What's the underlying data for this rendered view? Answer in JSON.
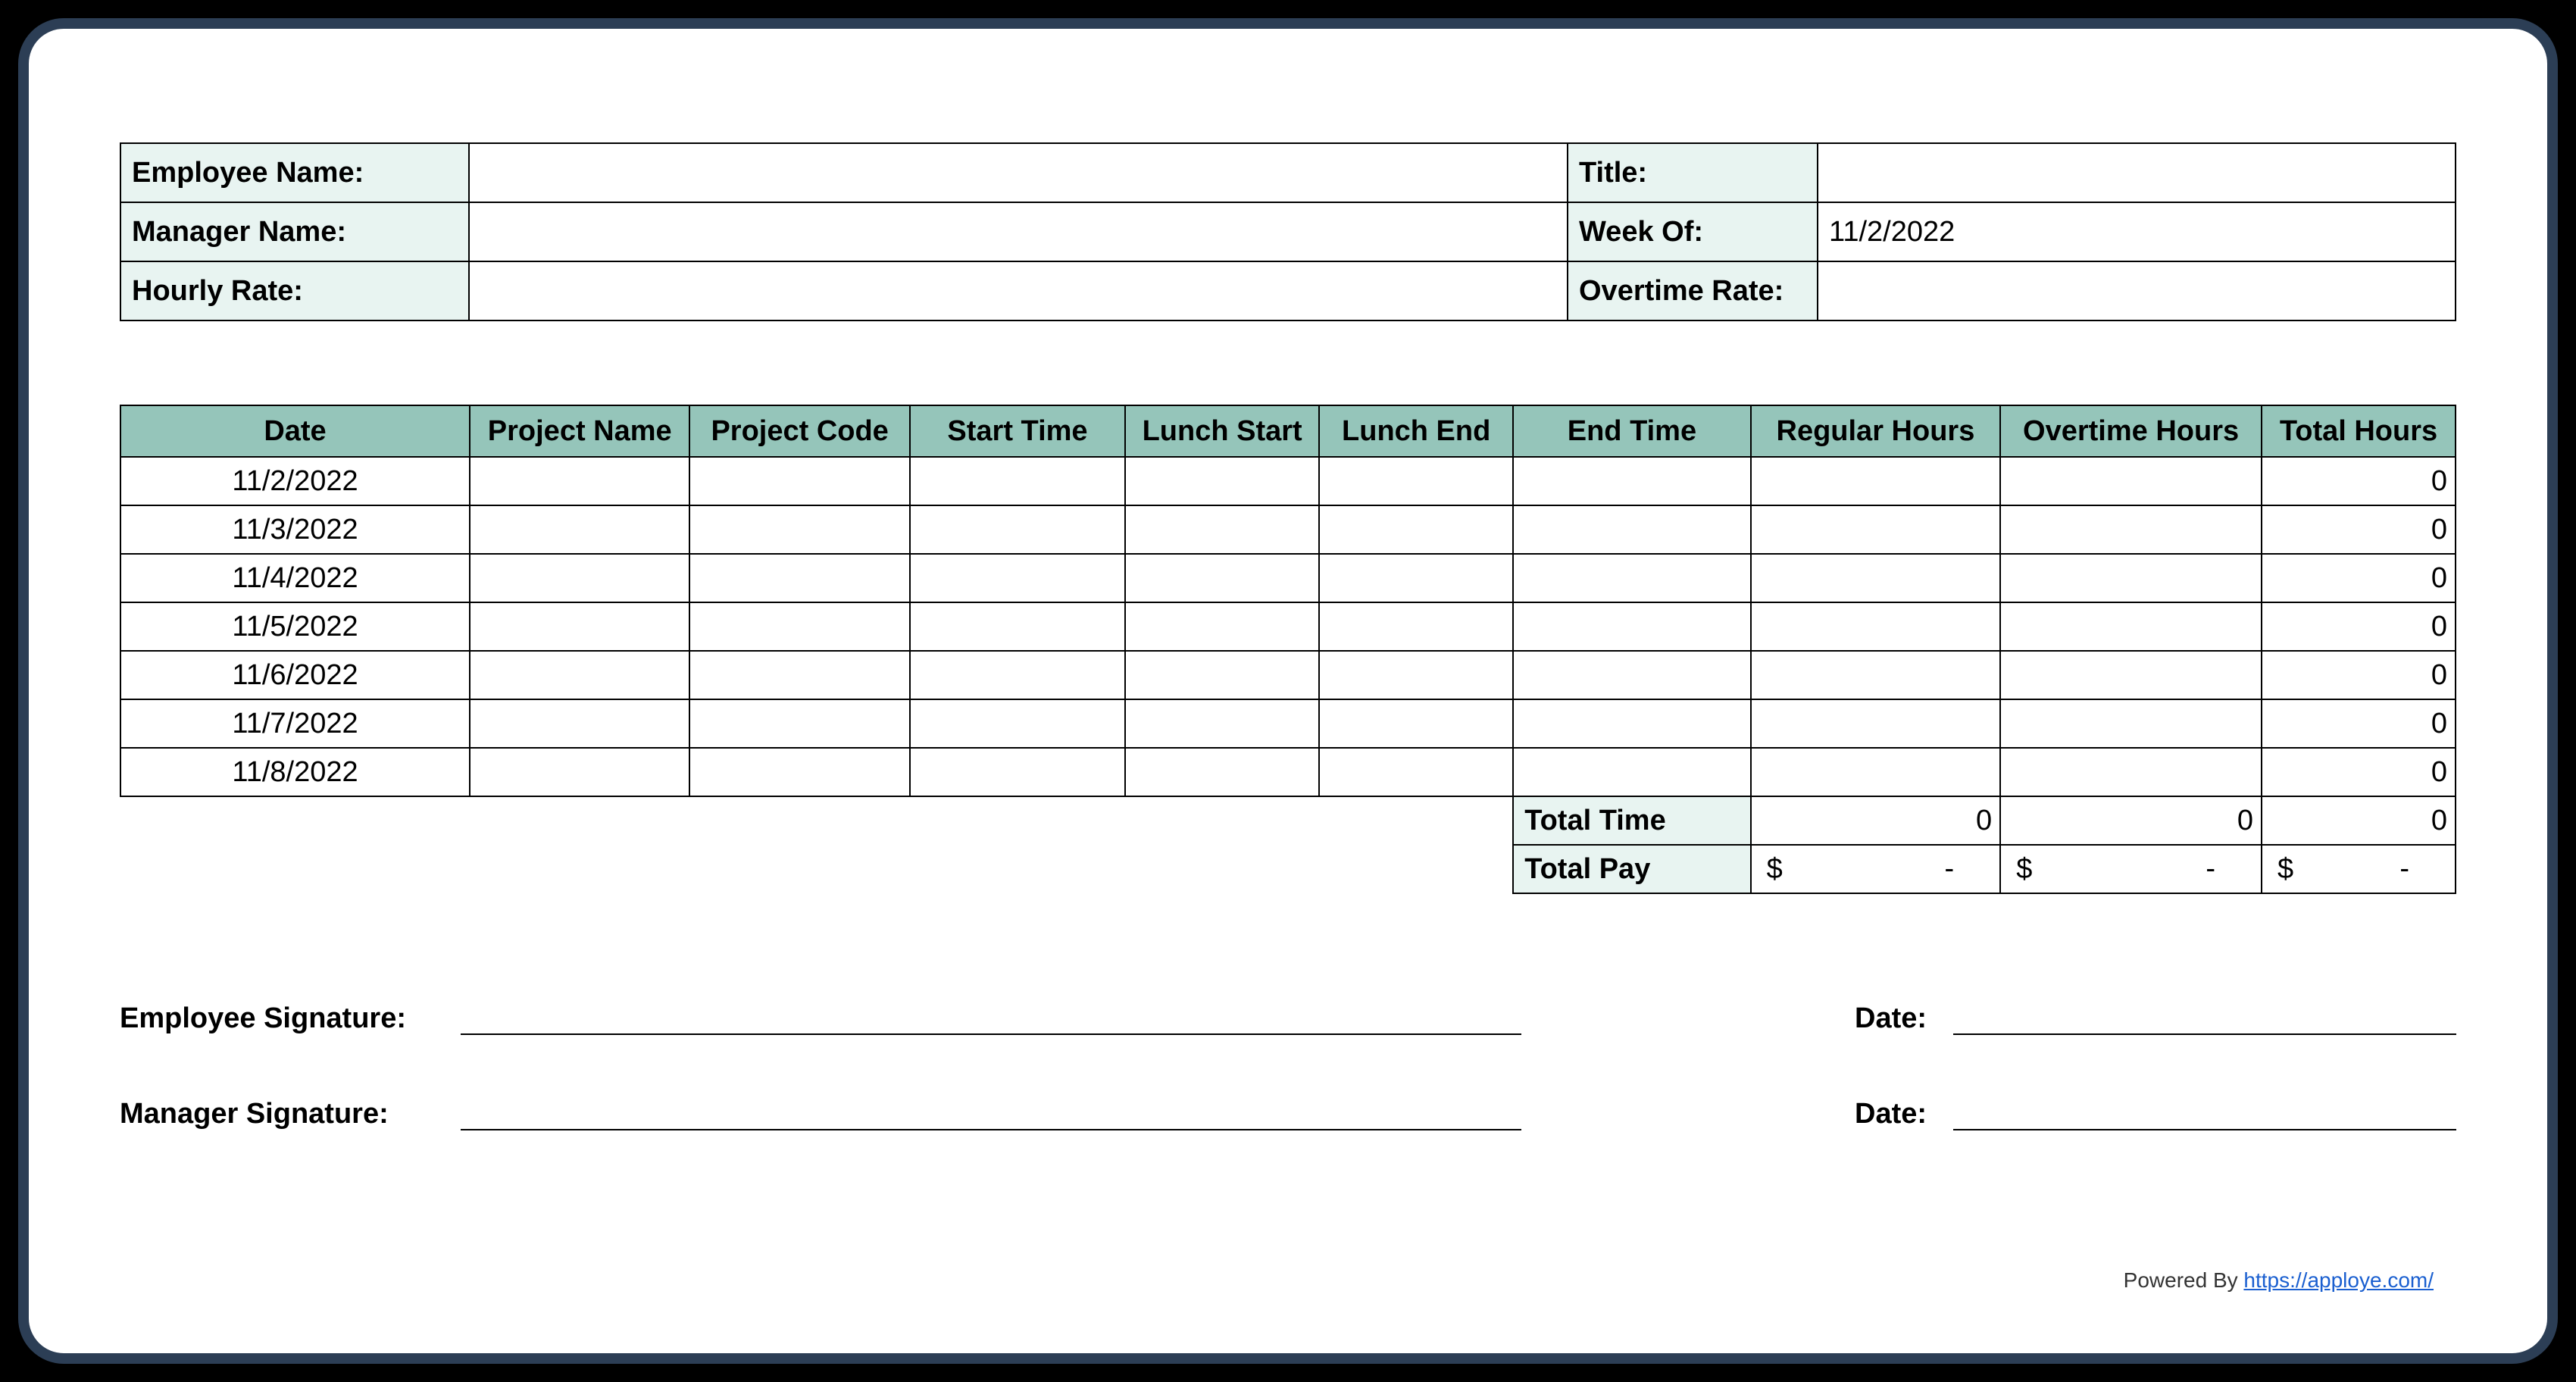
{
  "info": {
    "employee_name_label": "Employee Name:",
    "employee_name_value": "",
    "title_label": "Title:",
    "title_value": "",
    "manager_name_label": "Manager Name:",
    "manager_name_value": "",
    "week_of_label": "Week Of:",
    "week_of_value": "11/2/2022",
    "hourly_rate_label": "Hourly Rate:",
    "hourly_rate_value": "",
    "overtime_rate_label": "Overtime Rate:",
    "overtime_rate_value": ""
  },
  "columns": {
    "date": "Date",
    "project_name": "Project Name",
    "project_code": "Project Code",
    "start_time": "Start Time",
    "lunch_start": "Lunch Start",
    "lunch_end": "Lunch End",
    "end_time": "End Time",
    "regular_hours": "Regular Hours",
    "overtime_hours": "Overtime Hours",
    "total_hours": "Total Hours"
  },
  "rows": [
    {
      "date": "11/2/2022",
      "project_name": "",
      "project_code": "",
      "start_time": "",
      "lunch_start": "",
      "lunch_end": "",
      "end_time": "",
      "regular_hours": "",
      "overtime_hours": "",
      "total_hours": "0"
    },
    {
      "date": "11/3/2022",
      "project_name": "",
      "project_code": "",
      "start_time": "",
      "lunch_start": "",
      "lunch_end": "",
      "end_time": "",
      "regular_hours": "",
      "overtime_hours": "",
      "total_hours": "0"
    },
    {
      "date": "11/4/2022",
      "project_name": "",
      "project_code": "",
      "start_time": "",
      "lunch_start": "",
      "lunch_end": "",
      "end_time": "",
      "regular_hours": "",
      "overtime_hours": "",
      "total_hours": "0"
    },
    {
      "date": "11/5/2022",
      "project_name": "",
      "project_code": "",
      "start_time": "",
      "lunch_start": "",
      "lunch_end": "",
      "end_time": "",
      "regular_hours": "",
      "overtime_hours": "",
      "total_hours": "0"
    },
    {
      "date": "11/6/2022",
      "project_name": "",
      "project_code": "",
      "start_time": "",
      "lunch_start": "",
      "lunch_end": "",
      "end_time": "",
      "regular_hours": "",
      "overtime_hours": "",
      "total_hours": "0"
    },
    {
      "date": "11/7/2022",
      "project_name": "",
      "project_code": "",
      "start_time": "",
      "lunch_start": "",
      "lunch_end": "",
      "end_time": "",
      "regular_hours": "",
      "overtime_hours": "",
      "total_hours": "0"
    },
    {
      "date": "11/8/2022",
      "project_name": "",
      "project_code": "",
      "start_time": "",
      "lunch_start": "",
      "lunch_end": "",
      "end_time": "",
      "regular_hours": "",
      "overtime_hours": "",
      "total_hours": "0"
    }
  ],
  "totals": {
    "total_time_label": "Total Time",
    "total_time_regular": "0",
    "total_time_overtime": "0",
    "total_time_total": "0",
    "total_pay_label": "Total Pay",
    "pay_currency": "$",
    "pay_dash": "-"
  },
  "signatures": {
    "employee_signature_label": "Employee Signature:",
    "manager_signature_label": "Manager Signature:",
    "date_label": "Date:"
  },
  "footer": {
    "powered_by_text": "Powered By ",
    "link_text": "https://apploye.com/"
  }
}
